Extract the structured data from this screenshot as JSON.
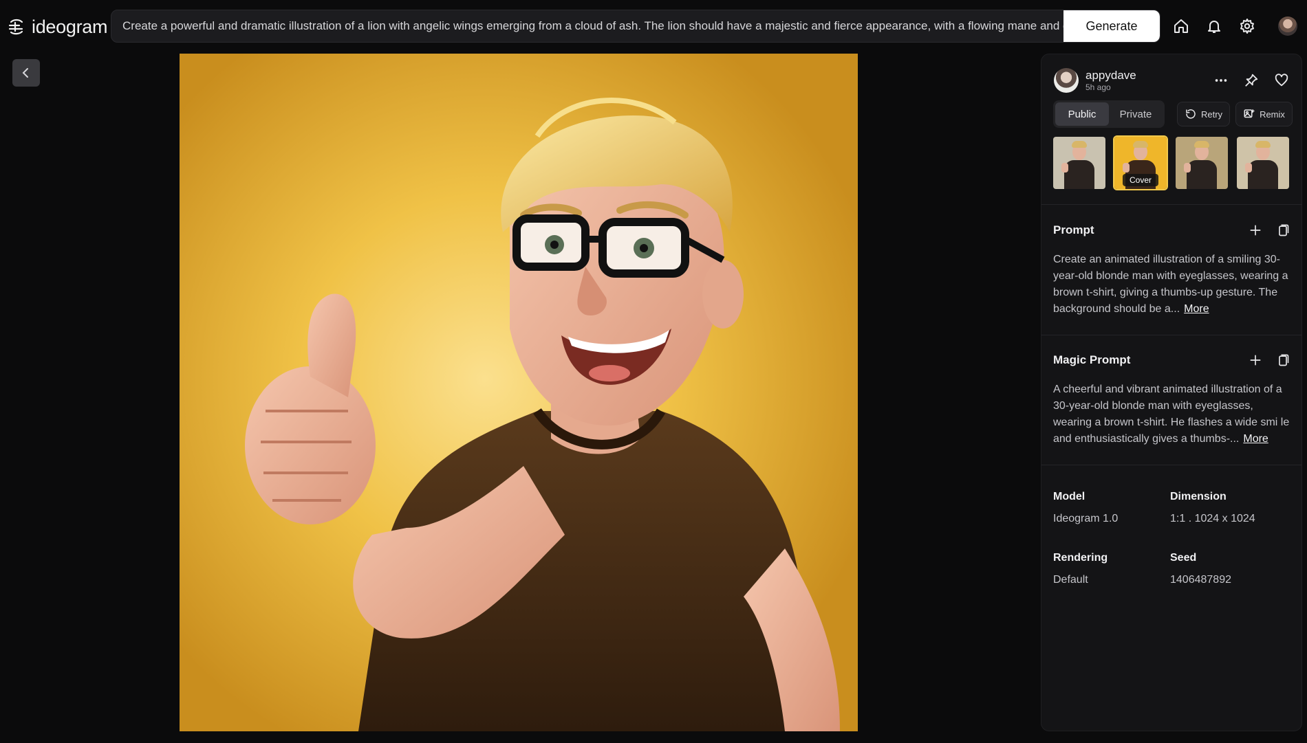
{
  "app": {
    "logo_text": "ideogram"
  },
  "prompt_bar": {
    "value": "Create a powerful and dramatic illustration of a lion with angelic wings emerging from a cloud of ash. The lion should have a majestic and fierce appearance, with a flowing mane and detail",
    "generate_label": "Generate"
  },
  "top_nav": {
    "icons": [
      "home-icon",
      "bell-icon",
      "gear-icon",
      "profile-avatar"
    ]
  },
  "panel": {
    "user": {
      "name": "appydave",
      "time": "5h ago"
    },
    "visibility": {
      "options": [
        "Public",
        "Private"
      ],
      "selected": "Public"
    },
    "actions": {
      "retry_label": "Retry",
      "remix_label": "Remix"
    },
    "thumbnails": {
      "count": 4,
      "cover_index": 1,
      "cover_label": "Cover"
    },
    "prompt": {
      "title": "Prompt",
      "text": "Create an animated illustration of a smiling 30-year-old blonde man with eyeglasses, wearing a brown t-shirt, giving a thumbs-up gesture. The background should be a...",
      "more_label": "More"
    },
    "magic_prompt": {
      "title": "Magic Prompt",
      "text": "A cheerful and vibrant animated illustration of a 30-year-old blonde man with eyeglasses, wearing a brown t-shirt. He flashes a wide smi le and enthusiastically gives a thumbs-...",
      "more_label": "More"
    },
    "details": {
      "model_label": "Model",
      "model_value": "Ideogram 1.0",
      "dimension_label": "Dimension",
      "dimension_value": "1:1 . 1024 x 1024",
      "rendering_label": "Rendering",
      "rendering_value": "Default",
      "seed_label": "Seed",
      "seed_value": "1406487892"
    }
  },
  "colors": {
    "background": "#0b0b0c",
    "panel": "#141416",
    "image_bg": "#efbf3e",
    "accent_button": "#ffffff"
  }
}
